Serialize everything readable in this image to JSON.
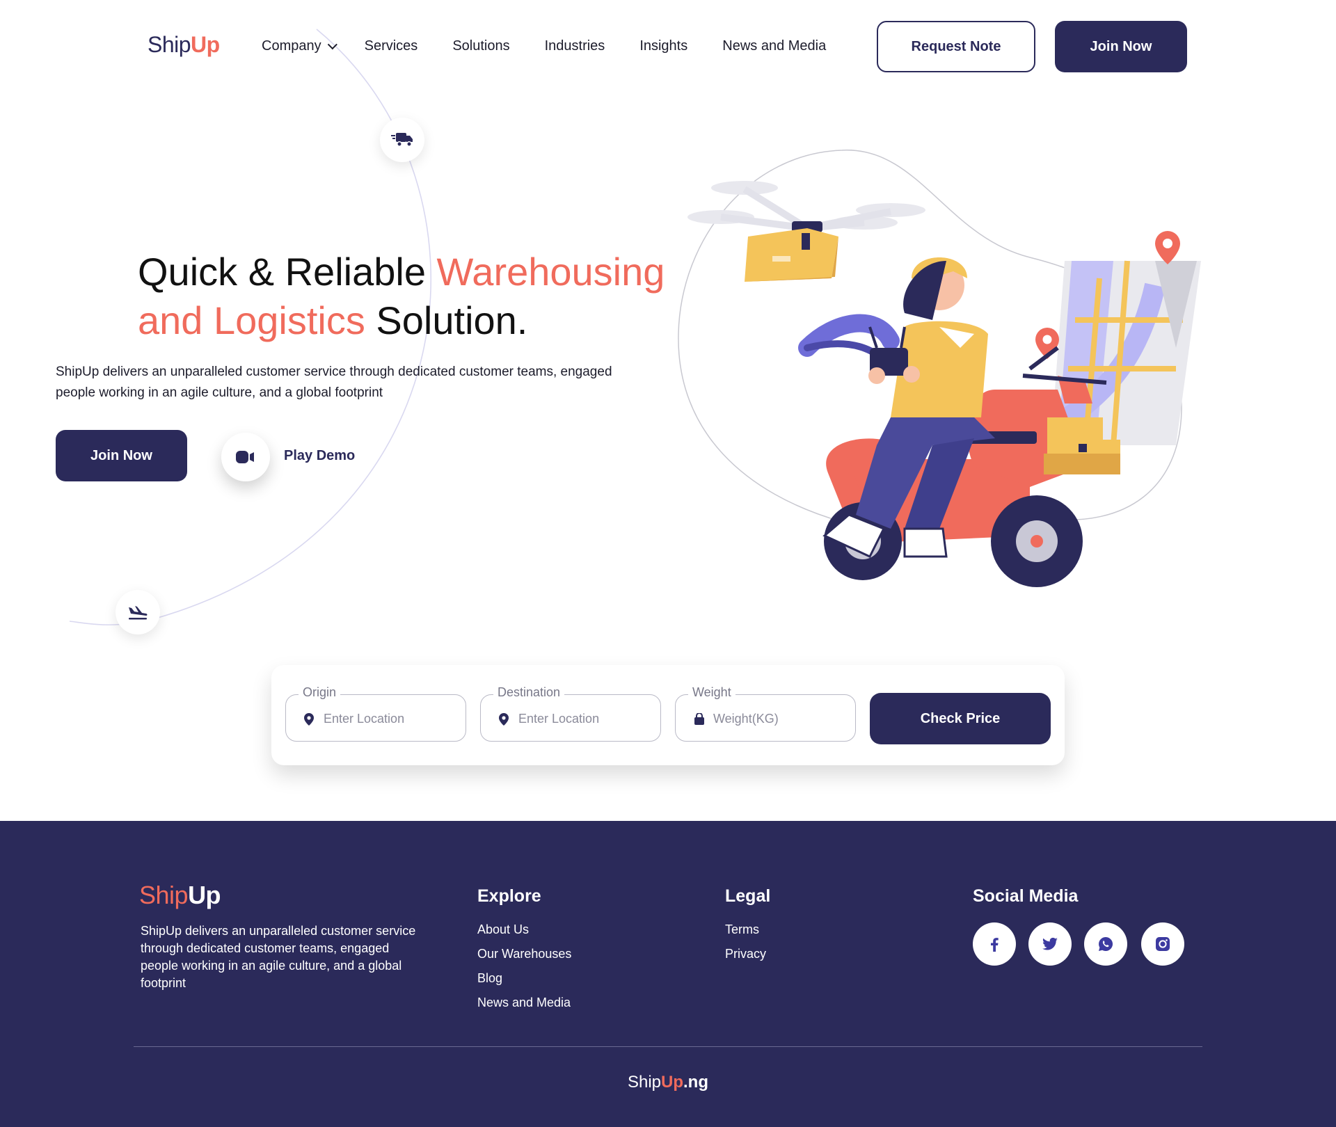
{
  "brand": {
    "logo_part1": "Ship",
    "logo_part2": "Up"
  },
  "nav": {
    "items": [
      "Company",
      "Services",
      "Solutions",
      "Industries",
      "Insights",
      "News and Media"
    ],
    "request_note_label": "Request Note",
    "join_now_label": "Join Now"
  },
  "hero": {
    "title_part1": "Quick & Reliable ",
    "title_accent1": "Warehousing",
    "title_accent2": "and Logistics",
    "title_part2": " Solution.",
    "description": "ShipUp delivers an unparalleled customer service through dedicated customer teams, engaged people working in an agile culture, and a global footprint",
    "join_now_label": "Join Now",
    "play_demo_label": "Play Demo"
  },
  "search": {
    "origin": {
      "legend": "Origin",
      "placeholder": "Enter Location",
      "value": ""
    },
    "destination": {
      "legend": "Destination",
      "placeholder": "Enter Location",
      "value": ""
    },
    "weight": {
      "legend": "Weight",
      "placeholder": "Weight(KG)",
      "value": ""
    },
    "check_price_label": "Check Price"
  },
  "footer": {
    "logo_part1": "Ship",
    "logo_part2": "Up",
    "description": "ShipUp delivers an unparalleled customer service through dedicated customer teams, engaged people working in an agile culture, and a global footprint",
    "explore": {
      "heading": "Explore",
      "links": [
        "About Us",
        "Our Warehouses",
        "Blog",
        "News and Media"
      ]
    },
    "legal": {
      "heading": "Legal",
      "links": [
        "Terms",
        "Privacy"
      ]
    },
    "social": {
      "heading": "Social Media",
      "icons": [
        "facebook-icon",
        "twitter-icon",
        "whatsapp-icon",
        "instagram-icon"
      ]
    },
    "bottom_part1": "Ship",
    "bottom_part2": "Up",
    "bottom_part3": ".ng"
  },
  "colors": {
    "navy": "#2b2a5a",
    "coral": "#f06b5c",
    "mustard": "#f4c45a",
    "lavender": "#b8b6f5"
  }
}
